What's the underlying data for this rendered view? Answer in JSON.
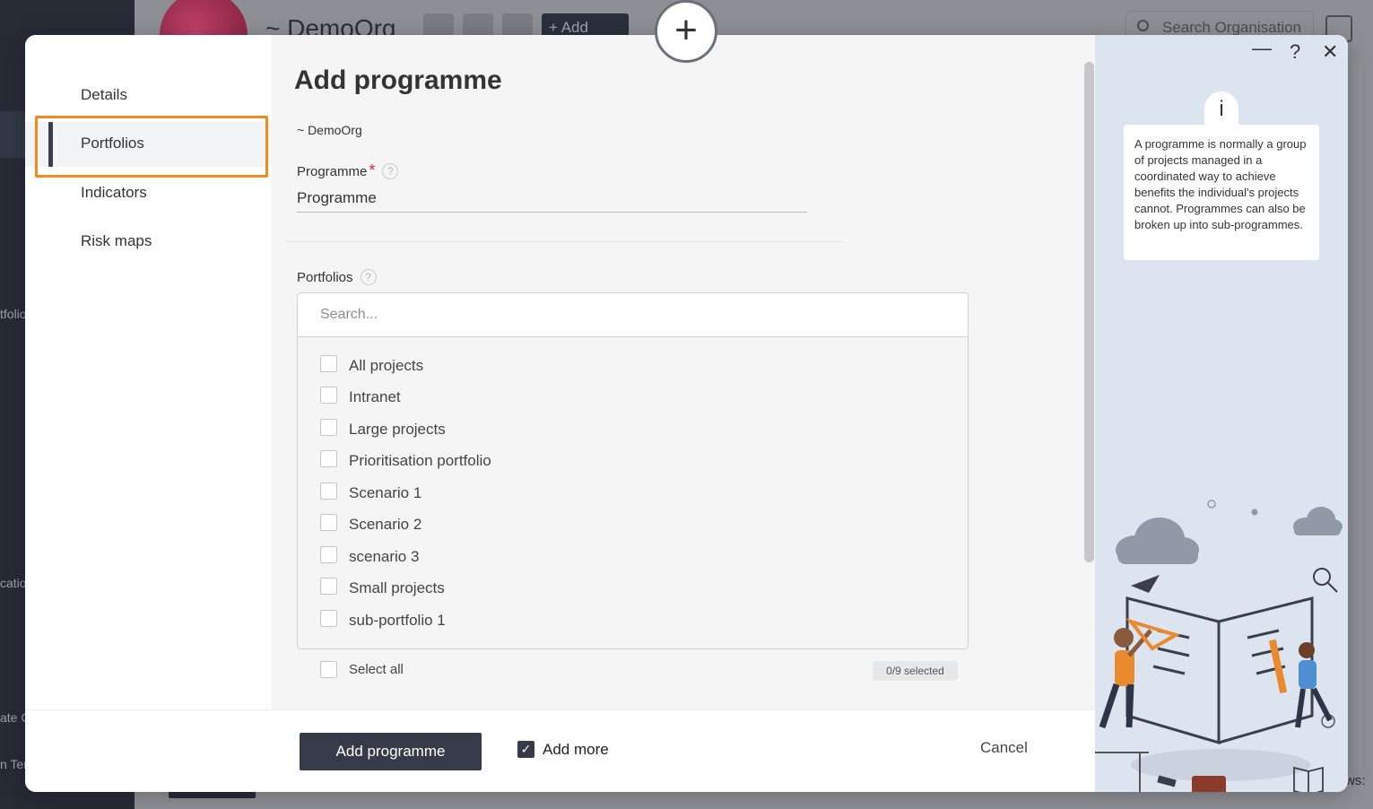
{
  "background": {
    "org_name": "~ DemoOrg",
    "add_button": "+ Add",
    "search_placeholder": "Search Organisation",
    "side_fragments": [
      "tfolio",
      "catio",
      "ate C",
      "n Ter"
    ],
    "right_fragment": "ws:"
  },
  "modal": {
    "nav": {
      "items": [
        {
          "label": "Details",
          "active": false
        },
        {
          "label": "Portfolios",
          "active": true
        },
        {
          "label": "Indicators",
          "active": false
        },
        {
          "label": "Risk maps",
          "active": false
        }
      ]
    },
    "title": "Add programme",
    "org": "~ DemoOrg",
    "programme_field": {
      "label": "Programme",
      "required_marker": "*",
      "value": "Programme"
    },
    "portfolios_field": {
      "label": "Portfolios",
      "search_placeholder": "Search...",
      "options": [
        "All projects",
        "Intranet",
        "Large projects",
        "Prioritisation portfolio",
        "Scenario 1",
        "Scenario 2",
        "scenario 3",
        "Small projects",
        "sub-portfolio 1"
      ],
      "select_all_label": "Select all",
      "selected_count": "0/9 selected"
    },
    "footer": {
      "primary_label": "Add programme",
      "add_more_label": "Add more",
      "add_more_checked": true,
      "cancel_label": "Cancel"
    },
    "help_panel": {
      "minimize_icon": "—",
      "help_icon": "?",
      "close_icon": "✕",
      "info_glyph": "i",
      "text": "A programme is normally a group of projects managed in a coordinated way to achieve benefits the individual's projects cannot. Programmes can also be broken up into sub-programmes."
    }
  },
  "floating_add_icon": "+"
}
